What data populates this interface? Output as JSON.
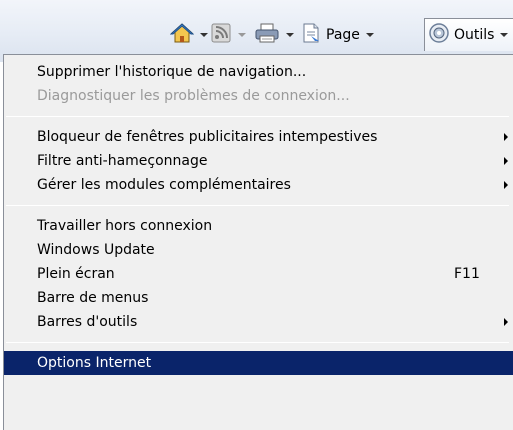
{
  "toolbar": {
    "home_icon": "home-icon",
    "feeds_icon": "feeds-icon",
    "print_icon": "print-icon",
    "page_label": "Page",
    "tools_label": "Outils"
  },
  "menu": {
    "group1": [
      {
        "label": "Supprimer l'historique de navigation...",
        "disabled": false
      },
      {
        "label": "Diagnostiquer les problèmes de connexion...",
        "disabled": true
      }
    ],
    "group2": [
      {
        "label": "Bloqueur de fenêtres publicitaires intempestives",
        "submenu": true
      },
      {
        "label": "Filtre anti-hameçonnage",
        "submenu": true
      },
      {
        "label": "Gérer les modules complémentaires",
        "submenu": true
      }
    ],
    "group3": [
      {
        "label": "Travailler hors connexion"
      },
      {
        "label": "Windows Update"
      },
      {
        "label": "Plein écran",
        "shortcut": "F11"
      },
      {
        "label": "Barre de menus"
      },
      {
        "label": "Barres d'outils",
        "submenu": true
      }
    ],
    "group4": [
      {
        "label": "Options Internet",
        "selected": true
      }
    ]
  },
  "colors": {
    "selection": "#0a246a",
    "menu_bg": "#f0f0f0",
    "disabled_text": "#9a9a9a"
  }
}
